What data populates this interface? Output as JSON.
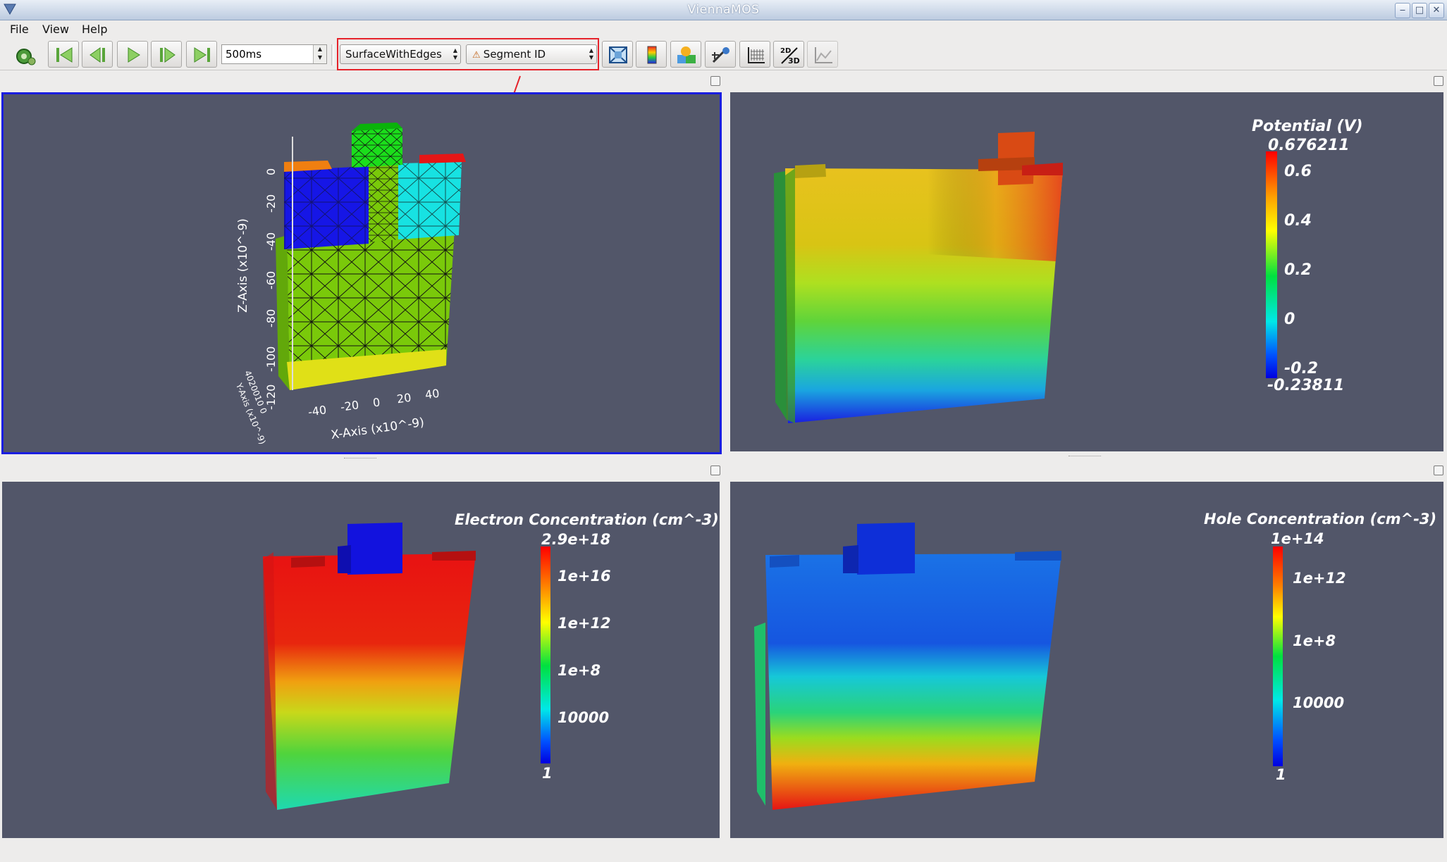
{
  "window": {
    "title": "ViennaMOS"
  },
  "menubar": {
    "items": [
      "File",
      "View",
      "Help"
    ]
  },
  "toolbar": {
    "interval": "500ms",
    "render_mode": "SurfaceWithEdges",
    "color_by": "Segment ID",
    "icons": [
      "plugin-icon",
      "first-frame-icon",
      "previous-frame-icon",
      "play-icon",
      "next-frame-icon",
      "last-frame-icon",
      "reset-camera-icon",
      "color-legend-icon",
      "segments-icon",
      "pick-icon",
      "grid-icon",
      "2d-3d-toggle-icon",
      "plot-icon"
    ],
    "toggle_2d3d": {
      "top": "2D",
      "bottom": "3D"
    }
  },
  "view1": {
    "z_axis_label": "Z-Axis (x10^-9)",
    "x_axis_label": "X-Axis (x10^-9)",
    "y_axis_label": "Y-Axis (x10^-9)",
    "z_ticks": [
      "0",
      "-20",
      "-40",
      "-60",
      "-80",
      "-100",
      "-120"
    ],
    "x_ticks": [
      "-40",
      "-20",
      "0",
      "20",
      "40"
    ],
    "y_ticks": "4020010 0"
  },
  "view2": {
    "legend_title": "Potential (V)",
    "max": "0.676211",
    "min": "-0.23811",
    "ticks": [
      "0.6",
      "0.4",
      "0.2",
      "0",
      "-0.2"
    ]
  },
  "view3": {
    "legend_title": "Electron Concentration (cm^-3)",
    "max": "2.9e+18",
    "min": "1",
    "ticks": [
      "1e+16",
      "1e+12",
      "1e+8",
      "10000"
    ]
  },
  "view4": {
    "legend_title": "Hole Concentration (cm^-3)",
    "max": "1e+14",
    "min": "1",
    "ticks": [
      "1e+12",
      "1e+8",
      "10000"
    ]
  },
  "colors": {
    "active_view_border": "#1a1ee0",
    "annotation": "#e5222a",
    "viewport_bg": "#525669"
  }
}
